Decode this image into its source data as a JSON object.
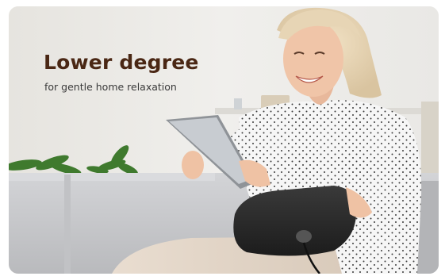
{
  "banner": {
    "headline": "Lower degree",
    "subline": "for gentle home relaxation"
  },
  "colors": {
    "headline": "#4a2714",
    "subline": "#3a3a3a",
    "background": "#ecebe7",
    "sofa": "#c9cacd",
    "sweater": "#f4f4f4",
    "massager": "#2b2b2b",
    "plant": "#3f7a2e"
  },
  "icons": {
    "photo": "woman-with-tablet-and-massager-photo"
  }
}
